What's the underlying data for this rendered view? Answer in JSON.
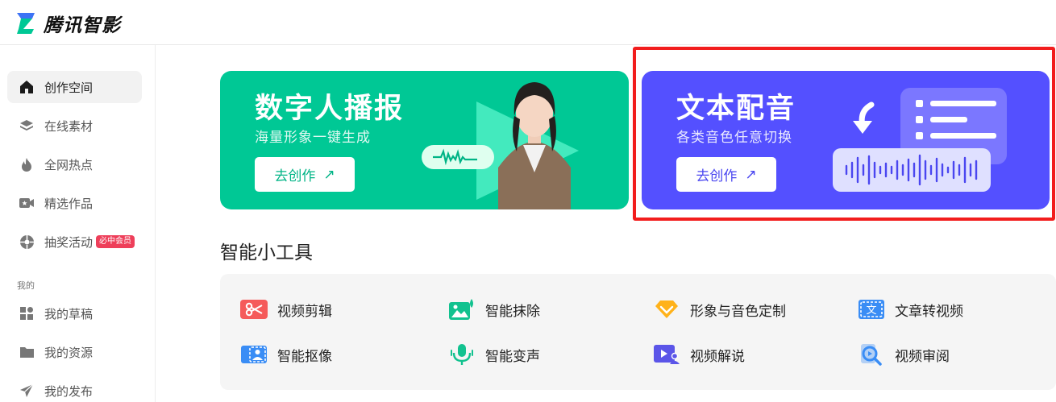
{
  "app": {
    "name": "腾讯智影"
  },
  "sidebar": {
    "items": [
      {
        "label": "创作空间",
        "icon": "home-icon",
        "active": true
      },
      {
        "label": "在线素材",
        "icon": "layers-icon"
      },
      {
        "label": "全网热点",
        "icon": "fire-icon"
      },
      {
        "label": "精选作品",
        "icon": "video-star-icon"
      },
      {
        "label": "抽奖活动",
        "icon": "lottery-icon",
        "badge": "必中会员"
      }
    ],
    "section_label": "我的",
    "my_items": [
      {
        "label": "我的草稿",
        "icon": "grid-icon"
      },
      {
        "label": "我的资源",
        "icon": "folder-icon"
      },
      {
        "label": "我的发布",
        "icon": "send-icon"
      }
    ]
  },
  "banners": [
    {
      "title": "数字人播报",
      "subtitle": "海量形象一键生成",
      "button": "去创作",
      "color": "#00c895"
    },
    {
      "title": "文本配音",
      "subtitle": "各类音色任意切换",
      "button": "去创作",
      "color": "#5450ff"
    }
  ],
  "tools": {
    "title": "智能小工具",
    "items": [
      {
        "label": "视频剪辑",
        "icon": "scissors-icon",
        "color": "#f55b5b"
      },
      {
        "label": "智能抹除",
        "icon": "image-erase-icon",
        "color": "#12c28f"
      },
      {
        "label": "形象与音色定制",
        "icon": "diamond-icon",
        "color": "#ffb21a"
      },
      {
        "label": "文章转视频",
        "icon": "text-to-video-icon",
        "color": "#3a8df5"
      },
      {
        "label": "智能抠像",
        "icon": "portrait-cutout-icon",
        "color": "#3a8df5"
      },
      {
        "label": "智能变声",
        "icon": "microphone-icon",
        "color": "#12c28f"
      },
      {
        "label": "视频解说",
        "icon": "video-narration-icon",
        "color": "#5b55e8"
      },
      {
        "label": "视频审阅",
        "icon": "video-review-icon",
        "color": "#3a8df5"
      }
    ]
  }
}
